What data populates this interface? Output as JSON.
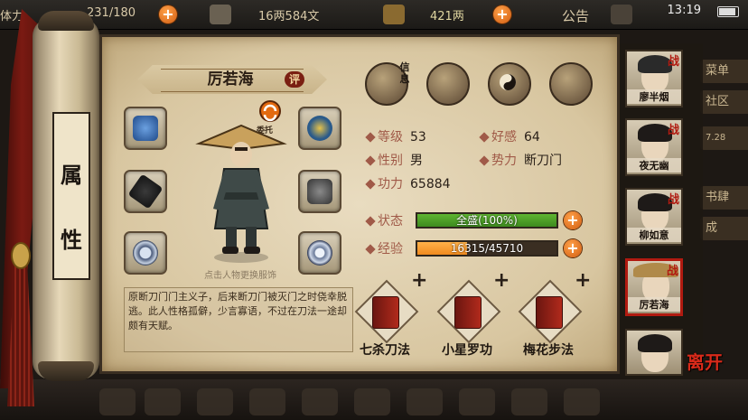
{
  "topbar": {
    "stamina": "231/180",
    "coins": "16两584文",
    "silver": "421两",
    "notice_label": "公告",
    "clock": "13:19",
    "partial_label": "体力"
  },
  "side_menu": {
    "items": [
      "菜单",
      "社区",
      "7.28",
      "书肆",
      "成"
    ]
  },
  "scroll": {
    "title_char_1": "属",
    "title_char_2": "性"
  },
  "hero": {
    "name": "厉若海",
    "rate_label": "评",
    "entrust_label": "委托",
    "change_outfit_hint": "点击人物更换服饰",
    "bio": "原断刀门门主义子，后来断刀门被灭门之时侥幸脱逃。此人性格孤僻，少言寡语，不过在刀法一途却颇有天赋。"
  },
  "tabs": {
    "info_label": "信息",
    "items": [
      "info-tab",
      "inventory-tab",
      "bagua-tab",
      "meridian-tab"
    ]
  },
  "attributes": {
    "level_label": "等级",
    "level": "53",
    "favor_label": "好感",
    "favor": "64",
    "gender_label": "性别",
    "gender": "男",
    "faction_label": "势力",
    "faction": "断刀门",
    "power_label": "功力",
    "power": "65884"
  },
  "status": {
    "label": "状态",
    "text": "全盛(100%)",
    "fraction": 1.0,
    "color": "#5fb532"
  },
  "experience": {
    "label": "经验",
    "text": "16315/45710",
    "fraction": 0.357,
    "color": "#f08a1e"
  },
  "skills": [
    {
      "name": "七杀刀法",
      "plus": "+"
    },
    {
      "name": "小星罗功",
      "plus": "+"
    },
    {
      "name": "梅花步法",
      "plus": "+"
    }
  ],
  "portraits": [
    {
      "name": "廖半烟",
      "war": "战"
    },
    {
      "name": "夜无幽",
      "war": "战"
    },
    {
      "name": "柳如意",
      "war": "战"
    },
    {
      "name": "厉若海",
      "war": "战"
    },
    {
      "name": "",
      "war": ""
    }
  ],
  "leave_button": "离开",
  "plus_sign": "+"
}
